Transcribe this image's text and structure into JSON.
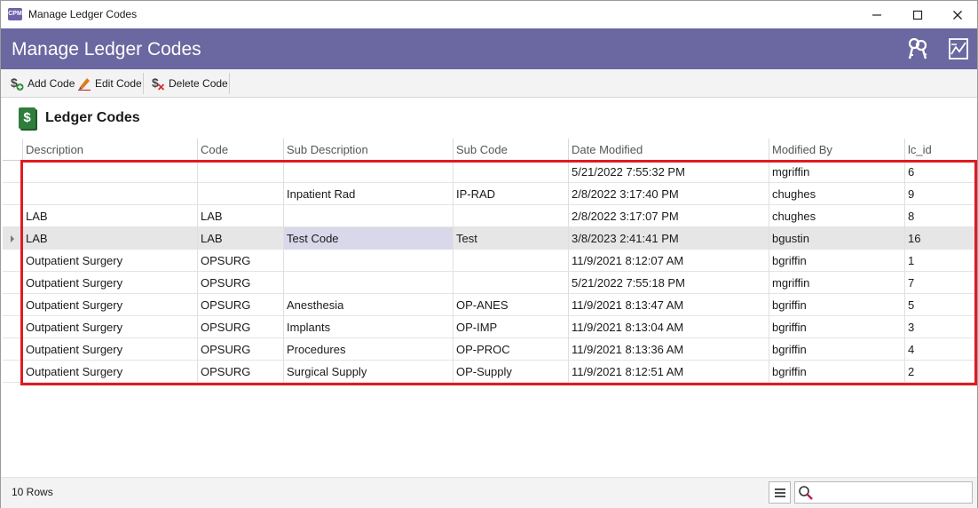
{
  "window": {
    "title": "Manage Ledger Codes",
    "app_icon_text": "CPM"
  },
  "header": {
    "title": "Manage Ledger Codes",
    "color": "#6b67a0"
  },
  "toolbar": {
    "add_label": "Add Code",
    "edit_label": "Edit Code",
    "delete_label": "Delete Code"
  },
  "section": {
    "title": "Ledger Codes",
    "icon_text": "$"
  },
  "grid": {
    "columns": [
      "Description",
      "Code",
      "Sub Description",
      "Sub Code",
      "Date Modified",
      "Modified By",
      "lc_id"
    ],
    "rows": [
      [
        "",
        "",
        "",
        "",
        "5/21/2022 7:55:32 PM",
        "mgriffin",
        "6"
      ],
      [
        "",
        "",
        "Inpatient Rad",
        "IP-RAD",
        "2/8/2022 3:17:40 PM",
        "chughes",
        "9"
      ],
      [
        "LAB",
        "LAB",
        "",
        "",
        "2/8/2022 3:17:07 PM",
        "chughes",
        "8"
      ],
      [
        "LAB",
        "LAB",
        "Test Code",
        "Test",
        "3/8/2023 2:41:41 PM",
        "bgustin",
        "16"
      ],
      [
        "Outpatient Surgery",
        "OPSURG",
        "",
        "",
        "11/9/2021 8:12:07 AM",
        "bgriffin",
        "1"
      ],
      [
        "Outpatient Surgery",
        "OPSURG",
        "",
        "",
        "5/21/2022 7:55:18 PM",
        "mgriffin",
        "7"
      ],
      [
        "Outpatient Surgery",
        "OPSURG",
        "Anesthesia",
        "OP-ANES",
        "11/9/2021 8:13:47 AM",
        "bgriffin",
        "5"
      ],
      [
        "Outpatient Surgery",
        "OPSURG",
        "Implants",
        "OP-IMP",
        "11/9/2021 8:13:04 AM",
        "bgriffin",
        "3"
      ],
      [
        "Outpatient Surgery",
        "OPSURG",
        "Procedures",
        "OP-PROC",
        "11/9/2021 8:13:36 AM",
        "bgriffin",
        "4"
      ],
      [
        "Outpatient Surgery",
        "OPSURG",
        "Surgical Supply",
        "OP-Supply",
        "11/9/2021 8:12:51 AM",
        "bgriffin",
        "2"
      ]
    ],
    "selected_row": 3,
    "focused_column": 2,
    "highlight_color": "#e01a22"
  },
  "status": {
    "row_count": "10 Rows",
    "search_value": ""
  }
}
